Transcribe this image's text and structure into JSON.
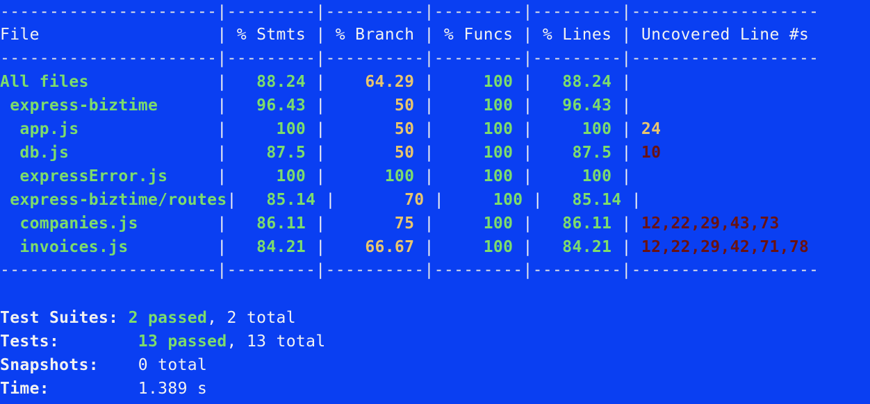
{
  "separator": "----------------------|---------|----------|---------|---------|-------------------",
  "headers": [
    "File",
    "% Stmts",
    "% Branch",
    "% Funcs",
    "% Lines",
    "Uncovered Line #s"
  ],
  "rows": [
    {
      "file": "All files",
      "indent": 0,
      "stmts": "88.24",
      "branch": "64.29",
      "funcs": "100",
      "lines": "88.24",
      "uncovered": "",
      "stmts_color": "green",
      "branch_color": "yellow",
      "uncovered_color": ""
    },
    {
      "file": "express-biztime",
      "indent": 1,
      "stmts": "96.43",
      "branch": "50",
      "funcs": "100",
      "lines": "96.43",
      "uncovered": "",
      "stmts_color": "green",
      "branch_color": "yellow",
      "uncovered_color": ""
    },
    {
      "file": "app.js",
      "indent": 2,
      "stmts": "100",
      "branch": "50",
      "funcs": "100",
      "lines": "100",
      "uncovered": "24",
      "stmts_color": "green",
      "branch_color": "yellow",
      "uncovered_color": "yellow"
    },
    {
      "file": "db.js",
      "indent": 2,
      "stmts": "87.5",
      "branch": "50",
      "funcs": "100",
      "lines": "87.5",
      "uncovered": "10",
      "stmts_color": "green",
      "branch_color": "yellow",
      "uncovered_color": "red"
    },
    {
      "file": "expressError.js",
      "indent": 2,
      "stmts": "100",
      "branch": "100",
      "funcs": "100",
      "lines": "100",
      "uncovered": "",
      "stmts_color": "green",
      "branch_color": "green",
      "uncovered_color": ""
    },
    {
      "file": "express-biztime/routes",
      "indent": 1,
      "stmts": "85.14",
      "branch": "70",
      "funcs": "100",
      "lines": "85.14",
      "uncovered": "",
      "stmts_color": "green",
      "branch_color": "yellow",
      "uncovered_color": ""
    },
    {
      "file": "companies.js",
      "indent": 2,
      "stmts": "86.11",
      "branch": "75",
      "funcs": "100",
      "lines": "86.11",
      "uncovered": "12,22,29,43,73",
      "stmts_color": "green",
      "branch_color": "yellow",
      "uncovered_color": "red"
    },
    {
      "file": "invoices.js",
      "indent": 2,
      "stmts": "84.21",
      "branch": "66.67",
      "funcs": "100",
      "lines": "84.21",
      "uncovered": "12,22,29,42,71,78",
      "stmts_color": "green",
      "branch_color": "yellow",
      "uncovered_color": "red"
    }
  ],
  "summary": {
    "suites_label": "Test Suites:",
    "suites_passed": "2 passed",
    "suites_total": ", 2 total",
    "tests_label": "Tests:",
    "tests_passed": "13 passed",
    "tests_total": ", 13 total",
    "snapshots_label": "Snapshots:",
    "snapshots_value": "0 total",
    "time_label": "Time:",
    "time_value": "1.389 s"
  },
  "colors": {
    "background": "#0a3ff2",
    "green": "#7ddc6c",
    "yellow": "#e8c56e",
    "red": "#6a1212",
    "text": "#f2f2f2"
  }
}
